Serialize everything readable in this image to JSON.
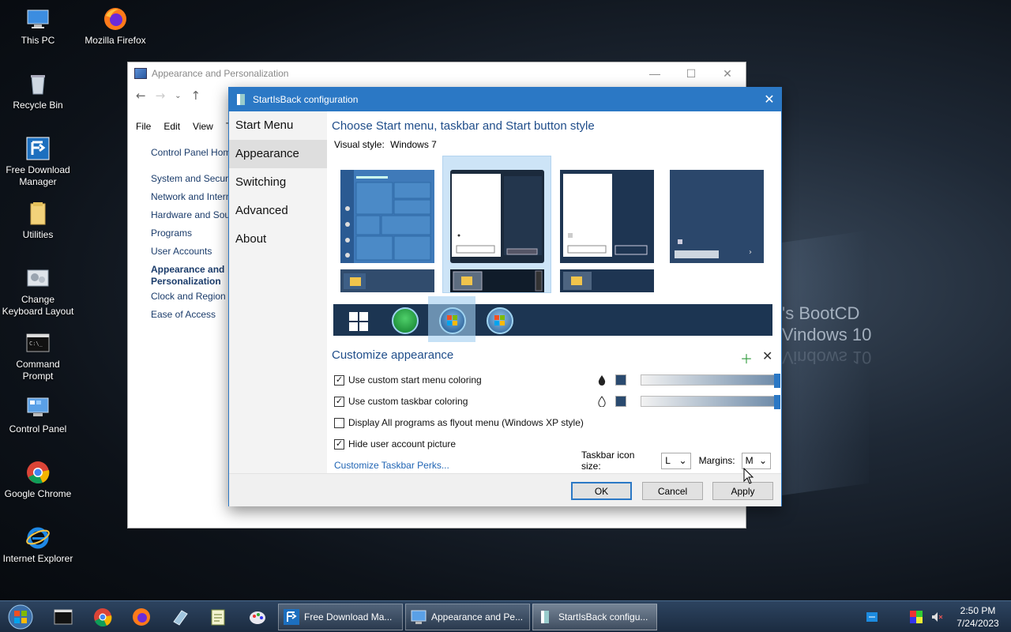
{
  "desktop": {
    "icons": [
      {
        "label": "This PC"
      },
      {
        "label": "Mozilla Firefox"
      },
      {
        "label": "Recycle Bin"
      },
      {
        "label": "Free Download Manager"
      },
      {
        "label": "Utilities"
      },
      {
        "label": "Change Keyboard Layout"
      },
      {
        "label": "Command Prompt"
      },
      {
        "label": "Control Panel"
      },
      {
        "label": "Google Chrome"
      },
      {
        "label": "Internet Explorer"
      }
    ],
    "wallpaper_lines": [
      "'s BootCD",
      "Vindows 10",
      "Vindows 10"
    ]
  },
  "control_panel": {
    "title": "Appearance and Personalization",
    "menu": [
      "File",
      "Edit",
      "View",
      "To"
    ],
    "home": "Control Panel Hom",
    "items": [
      "System and Securit",
      "Network and Intern",
      "Hardware and Soun",
      "Programs",
      "User Accounts"
    ],
    "active_item": "Appearance and Personalization",
    "items_after": [
      "Clock and Region",
      "Ease of Access"
    ]
  },
  "sib": {
    "title": "StartIsBack configuration",
    "nav": [
      "Start Menu",
      "Appearance",
      "Switching",
      "Advanced",
      "About"
    ],
    "heading": "Choose Start menu, taskbar and Start button style",
    "visual_style_label": "Visual style:",
    "visual_style_value": "Windows 7",
    "customize_heading": "Customize appearance",
    "checks": [
      {
        "label": "Use custom start menu coloring",
        "checked": true
      },
      {
        "label": "Use custom taskbar coloring",
        "checked": true
      },
      {
        "label": "Display All programs as flyout menu (Windows XP style)",
        "checked": false
      },
      {
        "label": "Hide user account picture",
        "checked": true
      }
    ],
    "check_mark": "✓",
    "perks_link": "Customize Taskbar Perks...",
    "icon_size_label": "Taskbar icon size:",
    "icon_size_value": "L",
    "margins_label": "Margins:",
    "margins_value": "M",
    "ok": "OK",
    "cancel": "Cancel",
    "apply": "Apply"
  },
  "taskbar": {
    "tasks": [
      {
        "label": "Free Download Ma..."
      },
      {
        "label": "Appearance and Pe..."
      },
      {
        "label": "StartIsBack configu..."
      }
    ],
    "time": "2:50 PM",
    "date": "7/24/2023"
  },
  "colors": {
    "accent": "#2b78c5",
    "heading": "#1f4d8a",
    "link": "#1f64b4"
  }
}
